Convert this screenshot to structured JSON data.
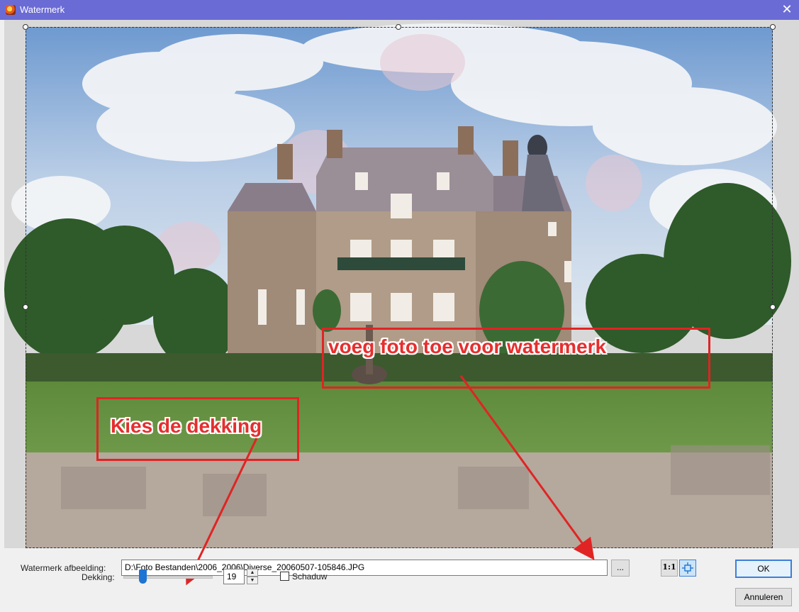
{
  "window": {
    "title": "Watermerk",
    "close_glyph": "✕",
    "app_icon": "watermark-app-icon"
  },
  "annotations": {
    "add_photo_text": "voeg  foto toe voor watermerk",
    "opacity_text": "Kies de dekking",
    "color": "#e02424"
  },
  "controls": {
    "watermark_label": "Watermerk afbeelding:",
    "watermark_path": "D:\\Foto Bestanden\\2006_2006\\Diverse_20060507-105846.JPG",
    "browse_label": "...",
    "actual_size_label": "1:1",
    "fit_icon": "fit-to-window-icon",
    "opacity_label": "Dekking:",
    "opacity_value": "19",
    "opacity_fraction": 0.19,
    "shadow_label": "Schaduw",
    "shadow_checked": false,
    "ok_label": "OK",
    "cancel_label": "Annuleren"
  },
  "colors": {
    "titlebar": "#6b6bd6",
    "accent": "#1e74d2"
  }
}
